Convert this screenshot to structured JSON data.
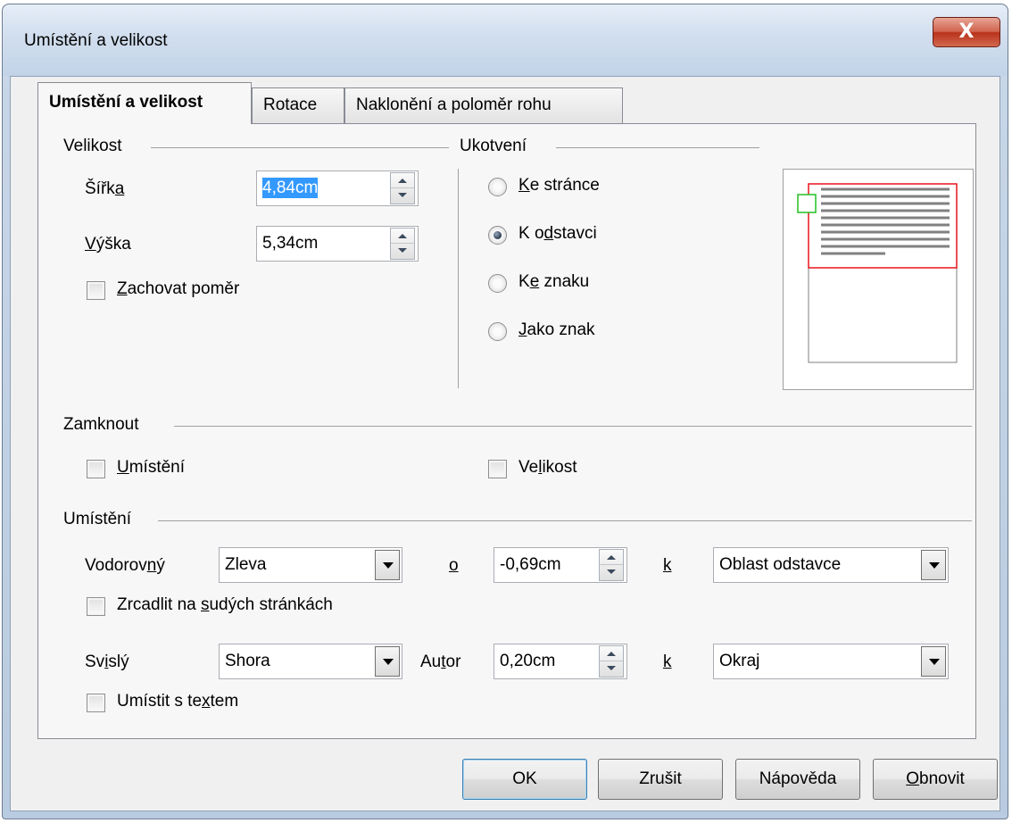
{
  "window": {
    "title": "Umístění a velikost",
    "close_glyph": "X"
  },
  "tabs": [
    {
      "label": "Umístění a velikost",
      "active": true
    },
    {
      "label": "Rotace",
      "active": false
    },
    {
      "label": "Naklonění a poloměr rohu",
      "active": false
    }
  ],
  "size": {
    "group_label": "Velikost",
    "width_label_pre": "Šířk",
    "width_label_u": "a",
    "width_value": "4,84cm",
    "height_label_u": "V",
    "height_label_post": "ýška",
    "height_value": "5,34cm",
    "keep_ratio_u": "Z",
    "keep_ratio_post": "achovat poměr",
    "keep_ratio_checked": false
  },
  "anchor": {
    "group_label": "Ukotvení",
    "options": [
      {
        "u": "K",
        "rest": "e stránce",
        "pre": "",
        "selected": false
      },
      {
        "pre": "K o",
        "u": "d",
        "rest": "stavci",
        "selected": true
      },
      {
        "pre": "K",
        "u": "e",
        "rest": " znaku",
        "selected": false
      },
      {
        "pre": "",
        "u": "J",
        "rest": "ako znak",
        "selected": false
      }
    ],
    "preview_colors": {
      "anchor_frame": "#e8141c",
      "anchor_marker": "#22c022",
      "text_lines": "#808080"
    }
  },
  "lock": {
    "group_label": "Zamknout",
    "position_u": "U",
    "position_rest": "místění",
    "position_checked": false,
    "size_pre": "Ve",
    "size_u": "l",
    "size_rest": "ikost",
    "size_checked": false
  },
  "position": {
    "group_label": "Umístění",
    "horizontal_pre": "Vodorov",
    "horizontal_u": "n",
    "horizontal_post": "ý",
    "horizontal_value": "Zleva",
    "horizontal_by_label": "o",
    "horizontal_offset": "-0,69cm",
    "horizontal_to_label": "k",
    "horizontal_to_value": "Oblast odstavce",
    "mirror_pre": "Zrcadlit na ",
    "mirror_u": "s",
    "mirror_post": "udých stránkách",
    "mirror_checked": false,
    "vertical_pre": "Sv",
    "vertical_u": "i",
    "vertical_post": "slý",
    "vertical_value": "Shora",
    "vertical_by_pre": "Au",
    "vertical_by_u": "t",
    "vertical_by_post": "or",
    "vertical_offset": "0,20cm",
    "vertical_to_label": "k",
    "vertical_to_value": "Okraj",
    "follow_pre": "Umístit s te",
    "follow_u": "x",
    "follow_post": "tem",
    "follow_checked": false
  },
  "buttons": {
    "ok": "OK",
    "cancel": "Zrušit",
    "help": "Nápověda",
    "reset_u": "O",
    "reset_rest": "bnovit"
  }
}
